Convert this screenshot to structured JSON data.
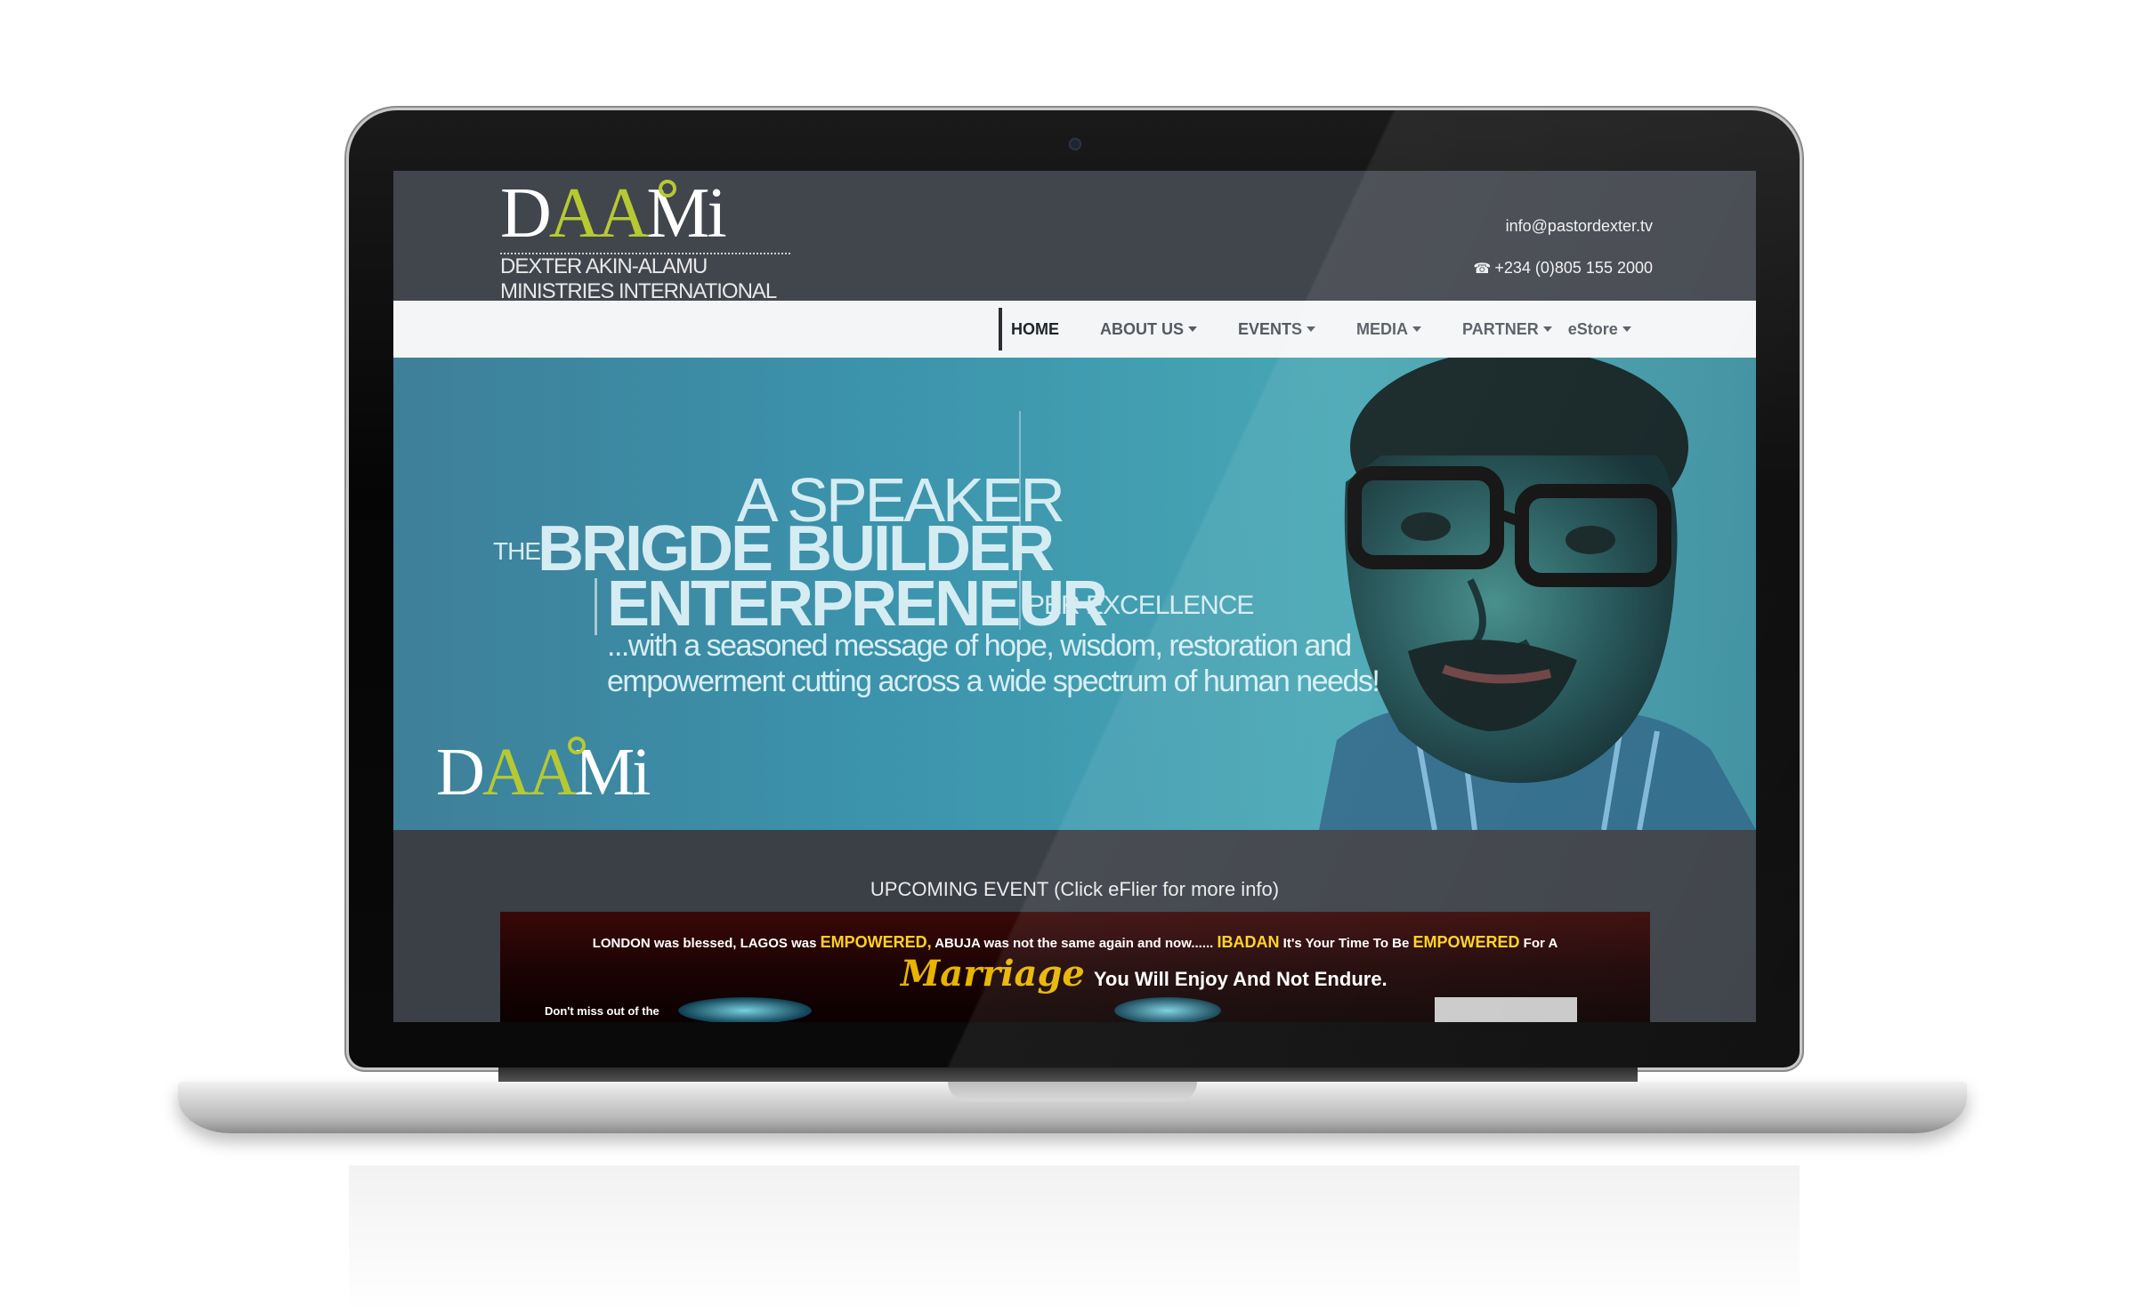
{
  "header": {
    "logo_text_d": "D",
    "logo_text_aa": "AA",
    "logo_text_mi": "Mi",
    "logo_name_line1": "DEXTER AKIN-ALAMU",
    "logo_name_line2": "MINISTRIES INTERNATIONAL",
    "email": "info@pastordexter.tv",
    "phone": "+234 (0)805 155 2000"
  },
  "nav": {
    "items": [
      {
        "label": "HOME",
        "active": true,
        "dropdown": false
      },
      {
        "label": "ABOUT US",
        "active": false,
        "dropdown": true
      },
      {
        "label": "EVENTS",
        "active": false,
        "dropdown": true
      },
      {
        "label": "MEDIA",
        "active": false,
        "dropdown": true
      },
      {
        "label": "PARTNER",
        "active": false,
        "dropdown": true
      },
      {
        "label": "eStore",
        "active": false,
        "dropdown": true
      }
    ]
  },
  "hero": {
    "line_speaker": "A SPEAKER",
    "line_the": "THE",
    "line_bridge": "BRIGDE BUILDER",
    "line_entrepreneur": "ENTERPRENEUR",
    "line_per": "PER EXCELLENCE",
    "message_line1": "...with a seasoned message of hope, wisdom, restoration and",
    "message_line2": "empowerment cutting across a wide spectrum of human needs!"
  },
  "event": {
    "title": "UPCOMING EVENT (Click eFlier for more info)",
    "flier": {
      "part1": "LONDON was blessed, LAGOS was ",
      "empowered1": "EMPOWERED,",
      "part2": " ABUJA was not the same again and now...... ",
      "ibadan": "IBADAN",
      "part3": " It's Your Time To Be ",
      "empowered2": "EMPOWERED",
      "part4": " For A",
      "marriage": "Marriage",
      "tagline": "You Will Enjoy And Not Endure.",
      "dont_miss": "Don't miss out of the"
    }
  },
  "colors": {
    "header_bg": "#41454c",
    "accent_green": "#b6c933",
    "hero_blue": "#3b93ac",
    "flier_yellow": "#ffd21a"
  },
  "icons": {
    "phone": "phone-icon",
    "caret": "caret-down-icon"
  }
}
